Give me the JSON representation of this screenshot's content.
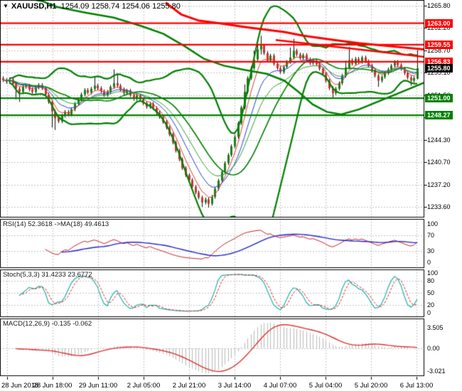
{
  "window": {
    "symbol_period": "XAUUSD,H1",
    "quote": {
      "open": "1254.09",
      "high": "1258.74",
      "low": "1254.06",
      "close": "1255.80"
    }
  },
  "price_axis_labels": [
    "1265.80",
    "1262.20",
    "1258.70",
    "1255.10",
    "1251.50",
    "1247.90",
    "1244.30",
    "1240.70",
    "1237.20",
    "1233.60"
  ],
  "time_axis_labels": [
    "28 Jun 2018",
    "28 Jun 18:00",
    "29 Jun 11:00",
    "2 Jul 05:00",
    "2 Jul 21:00",
    "3 Jul 14:00",
    "4 Jul 07:00",
    "5 Jul 04:00",
    "5 Jul 20:00",
    "6 Jul 13:00"
  ],
  "levels": {
    "resistance": [
      {
        "price": 1263.0,
        "label": "1263.00"
      },
      {
        "price": 1259.55,
        "label": "1259.55"
      },
      {
        "price": 1256.83,
        "label": "1256.83"
      }
    ],
    "support": [
      {
        "price": 1251.0,
        "label": "1251.00"
      },
      {
        "price": 1248.27,
        "label": "1248.27"
      }
    ],
    "current": {
      "price": 1255.8,
      "label": "1255.80"
    }
  },
  "indicators": {
    "rsi": {
      "label": "RSI(14) 52.3618  ->MA(18) 49.4613",
      "value": 52.3618,
      "ma_value": 49.4613,
      "period": 14,
      "ma_period": 18,
      "axis": [
        "100",
        "70",
        "30",
        "0"
      ],
      "grid_levels": [
        70,
        30
      ]
    },
    "stoch": {
      "label": "Stoch(5,3,3) 31.4233 23.6772",
      "value_k": 31.4233,
      "value_d": 23.6772,
      "k": 5,
      "d": 3,
      "slowing": 3,
      "axis": [
        "100",
        "80",
        "50",
        "20",
        "0"
      ],
      "grid_levels": [
        80,
        50,
        20
      ]
    },
    "macd": {
      "label": "MACD(12,26,9) -0.135 -0.062",
      "value": -0.135,
      "signal_value": -0.062,
      "fast": 12,
      "slow": 26,
      "signal": 9,
      "axis": [
        "3.505",
        "0.00",
        "-3.021"
      ]
    }
  },
  "colors": {
    "background": "#ffffff",
    "grid": "#c6c6c6",
    "bull": "#1a801a",
    "bear": "#cc3434",
    "wick": "#111111",
    "bands": "#008000",
    "support": "#008000",
    "resistance": "#ff0000",
    "red_ma": "#ff0000",
    "ma_fast": "#e53935",
    "ma_mid": "#2441cc",
    "ma_slow": "#2e9e2e",
    "rsi_line": "#cc2222",
    "rsi_ma": "#2222cc",
    "stoch_k": "#20b2aa",
    "stoch_d": "#dd2222",
    "macd_hist": "#b9b9b9",
    "macd_signal": "#e03030",
    "badge_current": "#000000"
  },
  "chart_data": {
    "type": "candlestick",
    "title": "XAUUSD,H1 1254.09 1258.74 1254.06 1255.80",
    "symbol": "XAUUSD",
    "timeframe": "H1",
    "ylim": [
      1233.6,
      1265.8
    ],
    "grid": true,
    "price_ticks": [
      1265.8,
      1262.2,
      1258.7,
      1255.1,
      1251.5,
      1247.9,
      1244.3,
      1240.7,
      1237.2,
      1233.6
    ],
    "time_ticks": [
      "28 Jun 2018",
      "28 Jun 18:00",
      "29 Jun 11:00",
      "2 Jul 05:00",
      "2 Jul 21:00",
      "3 Jul 14:00",
      "4 Jul 07:00",
      "5 Jul 04:00",
      "5 Jul 20:00",
      "6 Jul 13:00"
    ],
    "horizontal_lines": [
      {
        "price": 1263.0,
        "color": "#ff0000"
      },
      {
        "price": 1259.55,
        "color": "#ff0000"
      },
      {
        "price": 1256.83,
        "color": "#ff0000"
      },
      {
        "price": 1251.0,
        "color": "#008000"
      },
      {
        "price": 1248.27,
        "color": "#008000"
      }
    ],
    "last_price": 1255.8,
    "candles_ohlc": [
      [
        1254.2,
        1254.5,
        1253.6,
        1253.9
      ],
      [
        1253.9,
        1254.2,
        1253.3,
        1253.6
      ],
      [
        1253.6,
        1254.3,
        1253.3,
        1254.0
      ],
      [
        1254.0,
        1254.3,
        1253.0,
        1253.3
      ],
      [
        1253.3,
        1253.6,
        1250.8,
        1252.5
      ],
      [
        1252.5,
        1252.8,
        1250.4,
        1252.0
      ],
      [
        1252.0,
        1253.1,
        1251.7,
        1252.8
      ],
      [
        1252.8,
        1253.3,
        1252.5,
        1253.0
      ],
      [
        1253.0,
        1253.3,
        1252.1,
        1252.4
      ],
      [
        1252.4,
        1252.7,
        1251.7,
        1252.0
      ],
      [
        1252.0,
        1253.0,
        1251.7,
        1252.7
      ],
      [
        1252.7,
        1253.4,
        1252.4,
        1253.1
      ],
      [
        1253.1,
        1253.4,
        1252.3,
        1252.6
      ],
      [
        1252.6,
        1252.9,
        1251.3,
        1251.6
      ],
      [
        1251.6,
        1251.9,
        1250.1,
        1250.4
      ],
      [
        1250.4,
        1250.7,
        1246.3,
        1248.9
      ],
      [
        1248.9,
        1249.2,
        1245.9,
        1247.8
      ],
      [
        1247.8,
        1248.1,
        1247.0,
        1247.3
      ],
      [
        1247.3,
        1248.5,
        1247.0,
        1248.2
      ],
      [
        1248.2,
        1249.1,
        1247.9,
        1248.8
      ],
      [
        1248.8,
        1249.1,
        1248.1,
        1248.4
      ],
      [
        1248.4,
        1249.5,
        1248.1,
        1249.2
      ],
      [
        1249.2,
        1250.4,
        1248.9,
        1250.1
      ],
      [
        1250.1,
        1251.1,
        1249.8,
        1250.8
      ],
      [
        1250.8,
        1251.9,
        1250.5,
        1251.6
      ],
      [
        1251.6,
        1252.6,
        1251.3,
        1252.3
      ],
      [
        1252.3,
        1252.6,
        1251.6,
        1251.9
      ],
      [
        1251.9,
        1252.8,
        1251.6,
        1252.5
      ],
      [
        1252.5,
        1254.4,
        1252.2,
        1253.0
      ],
      [
        1253.0,
        1253.3,
        1252.3,
        1252.6
      ],
      [
        1252.6,
        1252.9,
        1251.8,
        1252.1
      ],
      [
        1252.1,
        1252.4,
        1251.2,
        1251.5
      ],
      [
        1251.5,
        1252.3,
        1251.2,
        1252.0
      ],
      [
        1252.0,
        1253.1,
        1251.7,
        1252.8
      ],
      [
        1252.8,
        1255.6,
        1252.5,
        1253.4
      ],
      [
        1253.4,
        1254.8,
        1252.7,
        1253.0
      ],
      [
        1253.0,
        1253.3,
        1252.1,
        1252.4
      ],
      [
        1252.4,
        1252.7,
        1251.5,
        1251.8
      ],
      [
        1251.8,
        1252.5,
        1251.5,
        1252.2
      ],
      [
        1252.2,
        1252.5,
        1251.2,
        1251.5
      ],
      [
        1251.5,
        1251.8,
        1250.6,
        1250.9
      ],
      [
        1250.9,
        1251.7,
        1250.6,
        1251.4
      ],
      [
        1251.4,
        1251.7,
        1250.5,
        1250.8
      ],
      [
        1250.8,
        1251.1,
        1249.9,
        1250.2
      ],
      [
        1250.2,
        1250.5,
        1249.3,
        1249.6
      ],
      [
        1249.6,
        1250.4,
        1249.3,
        1250.1
      ],
      [
        1250.1,
        1250.4,
        1249.1,
        1249.4
      ],
      [
        1249.4,
        1249.7,
        1248.4,
        1248.7
      ],
      [
        1248.7,
        1249.0,
        1247.7,
        1248.0
      ],
      [
        1248.0,
        1248.3,
        1246.9,
        1247.2
      ],
      [
        1247.2,
        1247.5,
        1246.0,
        1246.3
      ],
      [
        1246.3,
        1246.6,
        1244.9,
        1245.2
      ],
      [
        1245.2,
        1245.5,
        1243.6,
        1243.9
      ],
      [
        1243.9,
        1244.2,
        1242.3,
        1242.6
      ],
      [
        1242.6,
        1242.9,
        1240.9,
        1241.2
      ],
      [
        1241.2,
        1241.5,
        1239.5,
        1239.8
      ],
      [
        1239.8,
        1240.1,
        1238.4,
        1238.7
      ],
      [
        1238.7,
        1239.0,
        1237.6,
        1237.9
      ],
      [
        1237.9,
        1238.2,
        1236.5,
        1236.8
      ],
      [
        1236.8,
        1237.1,
        1235.6,
        1235.9
      ],
      [
        1235.9,
        1236.2,
        1234.8,
        1235.1
      ],
      [
        1235.1,
        1235.4,
        1233.6,
        1234.3
      ],
      [
        1234.3,
        1235.1,
        1234.0,
        1234.8
      ],
      [
        1234.8,
        1235.1,
        1233.5,
        1234.1
      ],
      [
        1234.1,
        1235.5,
        1233.8,
        1235.2
      ],
      [
        1235.2,
        1236.8,
        1234.9,
        1236.5
      ],
      [
        1236.5,
        1238.1,
        1236.2,
        1237.8
      ],
      [
        1237.8,
        1239.5,
        1237.5,
        1239.2
      ],
      [
        1239.2,
        1240.9,
        1238.9,
        1240.6
      ],
      [
        1240.6,
        1242.2,
        1240.3,
        1241.9
      ],
      [
        1241.9,
        1243.6,
        1241.6,
        1243.3
      ],
      [
        1243.3,
        1245.1,
        1243.0,
        1244.8
      ],
      [
        1244.8,
        1247.3,
        1244.5,
        1247.0
      ],
      [
        1247.0,
        1249.8,
        1246.7,
        1249.5
      ],
      [
        1249.5,
        1253.2,
        1249.2,
        1252.0
      ],
      [
        1252.0,
        1254.5,
        1251.7,
        1254.2
      ],
      [
        1254.2,
        1256.1,
        1253.9,
        1255.8
      ],
      [
        1255.8,
        1258.6,
        1255.5,
        1257.2
      ],
      [
        1257.2,
        1260.4,
        1256.9,
        1258.8
      ],
      [
        1258.8,
        1261.0,
        1258.0,
        1259.4
      ],
      [
        1259.4,
        1259.7,
        1257.9,
        1258.2
      ],
      [
        1258.2,
        1258.5,
        1256.7,
        1257.0
      ],
      [
        1257.0,
        1258.1,
        1256.7,
        1257.8
      ],
      [
        1257.8,
        1258.1,
        1256.2,
        1256.5
      ],
      [
        1256.5,
        1256.8,
        1255.5,
        1255.8
      ],
      [
        1255.8,
        1256.1,
        1254.9,
        1255.2
      ],
      [
        1255.2,
        1256.3,
        1254.9,
        1256.0
      ],
      [
        1256.0,
        1257.1,
        1255.7,
        1256.8
      ],
      [
        1256.8,
        1259.1,
        1256.5,
        1257.5
      ],
      [
        1257.5,
        1260.5,
        1257.2,
        1258.6
      ],
      [
        1258.6,
        1258.9,
        1257.7,
        1258.0
      ],
      [
        1258.0,
        1258.3,
        1257.1,
        1257.4
      ],
      [
        1257.4,
        1258.2,
        1257.1,
        1257.9
      ],
      [
        1257.9,
        1258.2,
        1256.9,
        1257.2
      ],
      [
        1257.2,
        1257.5,
        1256.3,
        1256.6
      ],
      [
        1256.6,
        1257.3,
        1256.3,
        1257.0
      ],
      [
        1257.0,
        1257.3,
        1256.1,
        1256.4
      ],
      [
        1256.4,
        1256.7,
        1255.4,
        1255.7
      ],
      [
        1255.7,
        1256.0,
        1254.6,
        1254.9
      ],
      [
        1254.9,
        1255.2,
        1253.5,
        1253.8
      ],
      [
        1253.8,
        1254.1,
        1252.3,
        1252.6
      ],
      [
        1252.6,
        1252.9,
        1250.9,
        1251.8
      ],
      [
        1251.8,
        1252.8,
        1251.5,
        1252.5
      ],
      [
        1252.5,
        1253.7,
        1252.2,
        1253.4
      ],
      [
        1253.4,
        1254.9,
        1253.1,
        1254.6
      ],
      [
        1254.6,
        1257.0,
        1254.3,
        1255.9
      ],
      [
        1255.9,
        1259.2,
        1255.6,
        1257.1
      ],
      [
        1257.1,
        1257.4,
        1256.2,
        1256.5
      ],
      [
        1256.5,
        1257.6,
        1256.2,
        1257.3
      ],
      [
        1257.3,
        1257.6,
        1256.5,
        1256.8
      ],
      [
        1256.8,
        1257.8,
        1256.5,
        1257.5
      ],
      [
        1257.5,
        1257.8,
        1256.6,
        1256.9
      ],
      [
        1256.9,
        1257.2,
        1255.9,
        1256.2
      ],
      [
        1256.2,
        1256.5,
        1255.1,
        1255.4
      ],
      [
        1255.4,
        1255.7,
        1254.3,
        1254.6
      ],
      [
        1254.6,
        1254.9,
        1252.8,
        1253.8
      ],
      [
        1253.8,
        1254.7,
        1253.5,
        1254.4
      ],
      [
        1254.4,
        1255.3,
        1254.1,
        1255.0
      ],
      [
        1255.0,
        1255.9,
        1254.7,
        1255.6
      ],
      [
        1255.6,
        1256.5,
        1255.3,
        1256.2
      ],
      [
        1256.2,
        1257.1,
        1255.9,
        1256.8
      ],
      [
        1256.8,
        1257.1,
        1256.0,
        1256.3
      ],
      [
        1256.3,
        1256.6,
        1255.4,
        1255.7
      ],
      [
        1255.7,
        1256.0,
        1254.7,
        1255.0
      ],
      [
        1255.0,
        1255.3,
        1254.0,
        1254.3
      ],
      [
        1254.3,
        1254.6,
        1253.0,
        1253.8
      ],
      [
        1253.8,
        1254.5,
        1253.5,
        1254.2
      ],
      [
        1254.1,
        1258.7,
        1254.0,
        1255.8
      ]
    ],
    "overlays": {
      "bollinger": {
        "period": 20,
        "deviation": 2
      },
      "ma_fast_period": 5,
      "ma_mid_period": 10,
      "ma_slow_period": 16,
      "red_ma_polyline": [
        [
          233,
          1266.3
        ],
        [
          255,
          1264.4
        ],
        [
          280,
          1263.4
        ],
        [
          307,
          1263.0
        ],
        [
          350,
          1262.3
        ],
        [
          400,
          1261.6
        ],
        [
          427,
          1261.0
        ],
        [
          470,
          1260.3
        ],
        [
          505,
          1259.8
        ],
        [
          550,
          1259.3
        ],
        [
          597,
          1258.8
        ]
      ],
      "red_trendline": [
        [
          388,
          1260.3
        ],
        [
          597,
          1257.6
        ]
      ],
      "green_ma_polyline": [
        [
          0,
          1267.8
        ],
        [
          60,
          1266.5
        ],
        [
          80,
          1265.6
        ],
        [
          120,
          1264.7
        ],
        [
          160,
          1263.9
        ],
        [
          200,
          1262.5
        ],
        [
          230,
          1261.3
        ],
        [
          260,
          1259.3
        ],
        [
          287,
          1257.3
        ],
        [
          315,
          1256.2
        ],
        [
          345,
          1255.5
        ],
        [
          375,
          1254.9
        ],
        [
          400,
          1253.8
        ],
        [
          420,
          1252.0
        ],
        [
          440,
          1250.0
        ],
        [
          460,
          1248.8
        ],
        [
          480,
          1248.4
        ],
        [
          505,
          1249.2
        ],
        [
          535,
          1250.6
        ],
        [
          565,
          1252.0
        ],
        [
          597,
          1253.5
        ]
      ]
    }
  }
}
